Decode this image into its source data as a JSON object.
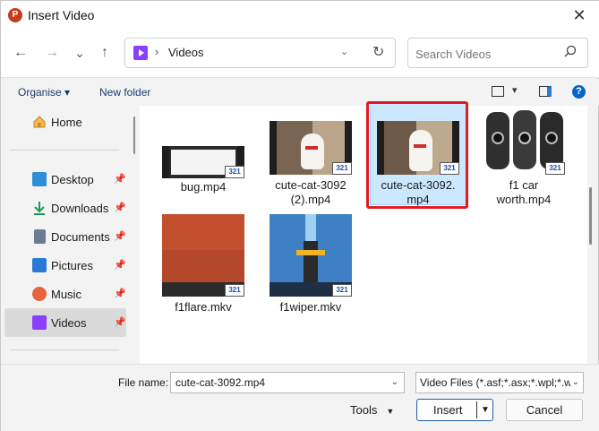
{
  "window": {
    "title": "Insert Video",
    "close_glyph": "✕"
  },
  "nav": {
    "back_glyph": "←",
    "forward_glyph": "→",
    "recent_glyph": "⌄",
    "up_glyph": "↑",
    "address": {
      "separator": "›",
      "location": "Videos",
      "dropdown_glyph": "⌄",
      "refresh_glyph": "↻"
    },
    "search": {
      "placeholder": "Search Videos"
    }
  },
  "commandbar": {
    "organise": "Organise ▾",
    "new_folder": "New folder",
    "view_dropdown_glyph": "▾",
    "help_glyph": "?"
  },
  "sidebar": {
    "items": [
      {
        "label": "Home",
        "icon": "home-icon",
        "pinned": false,
        "selected": false
      },
      {
        "label": "Desktop",
        "icon": "desktop-icon",
        "pinned": true,
        "selected": false
      },
      {
        "label": "Downloads",
        "icon": "downloads-icon",
        "pinned": true,
        "selected": false
      },
      {
        "label": "Documents",
        "icon": "documents-icon",
        "pinned": true,
        "selected": false
      },
      {
        "label": "Pictures",
        "icon": "pictures-icon",
        "pinned": true,
        "selected": false
      },
      {
        "label": "Music",
        "icon": "music-icon",
        "pinned": true,
        "selected": false
      },
      {
        "label": "Videos",
        "icon": "videos-icon",
        "pinned": true,
        "selected": true
      }
    ],
    "pin_glyph": "📌"
  },
  "files": [
    {
      "name": "bug.mp4",
      "kind": "screen-recording",
      "selected": false
    },
    {
      "name": "cute-cat-3092 (2).mp4",
      "kind": "cat",
      "selected": false
    },
    {
      "name": "cute-cat-3092.mp4",
      "kind": "cat",
      "selected": true
    },
    {
      "name": "f1 car worth.mp4",
      "kind": "watches",
      "selected": false
    },
    {
      "name": "f1flare.mkv",
      "kind": "flare",
      "selected": false
    },
    {
      "name": "f1wiper.mkv",
      "kind": "wiper",
      "selected": false
    }
  ],
  "thumbnail_badge": "321",
  "footer": {
    "file_name_label": "File name:",
    "file_name_value": "cute-cat-3092.mp4",
    "file_type_value": "Video Files (*.asf;*.asx;*.wpl;*.w",
    "tools_label": "Tools",
    "insert_label": "Insert",
    "cancel_label": "Cancel",
    "dropdown_glyph": "⌄"
  },
  "colors": {
    "selection_fill": "#cce8ff",
    "selection_border": "#99d1ff",
    "highlight_outline": "#e01b24",
    "accent": "#1f5ea8",
    "video_icon": "#8a3ffc"
  }
}
